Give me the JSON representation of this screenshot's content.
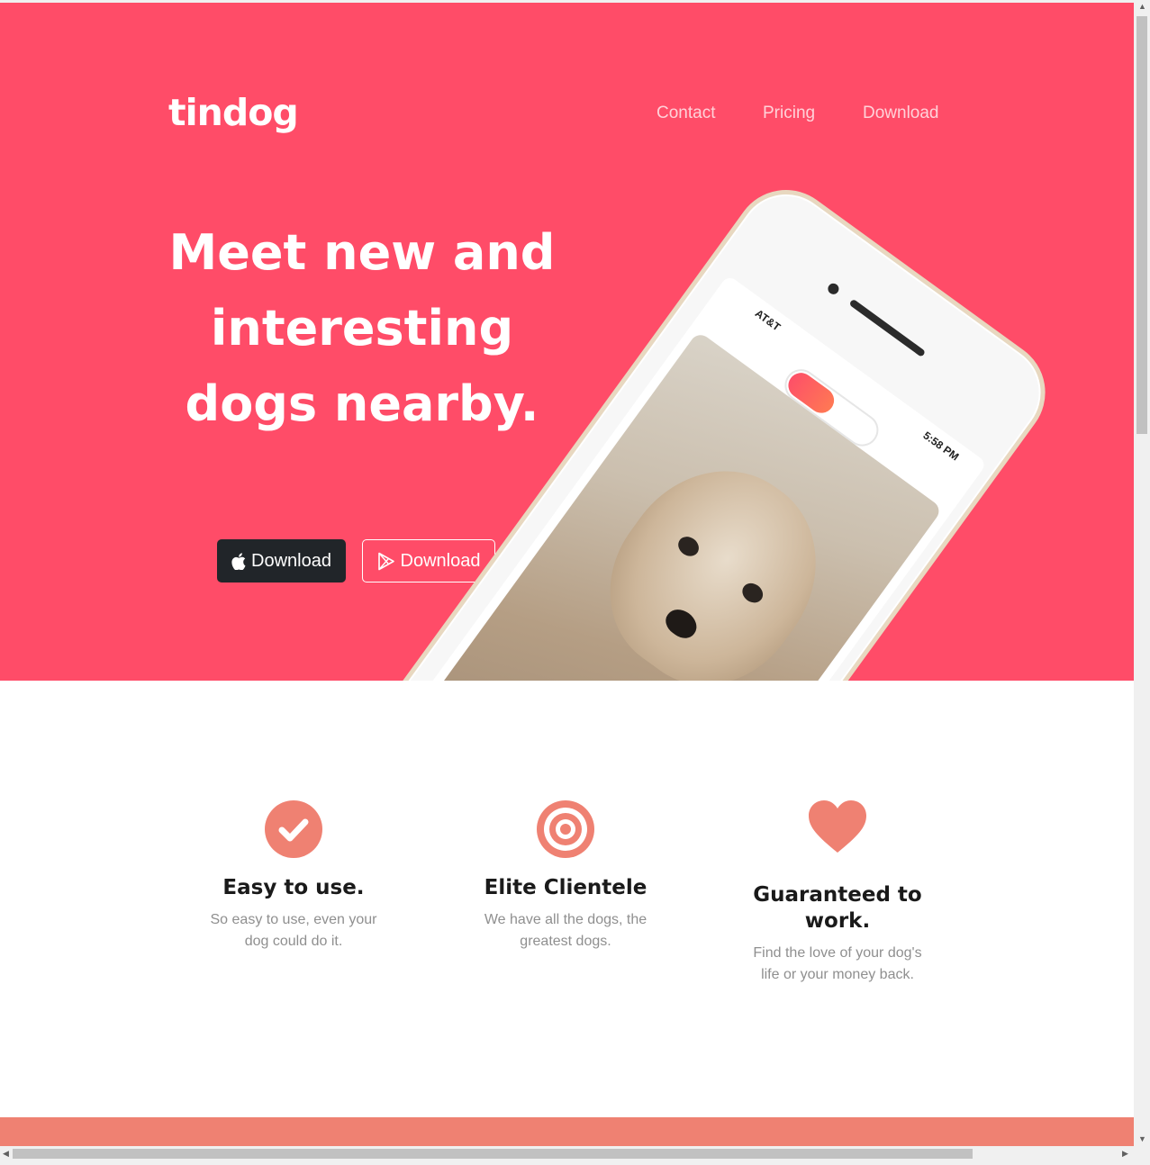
{
  "brand": "tindog",
  "nav": {
    "items": [
      {
        "label": "Contact"
      },
      {
        "label": "Pricing"
      },
      {
        "label": "Download"
      }
    ]
  },
  "hero": {
    "title": "Meet new and interesting dogs nearby.",
    "buttons": {
      "apple_label": "Download",
      "google_label": "Download"
    },
    "phone": {
      "carrier": "AT&T",
      "time": "5:58 PM"
    }
  },
  "features": [
    {
      "icon": "check-circle-icon",
      "title": "Easy to use.",
      "text": "So easy to use, even your dog could do it."
    },
    {
      "icon": "bullseye-icon",
      "title": "Elite Clientele",
      "text": "We have all the dogs, the greatest dogs."
    },
    {
      "icon": "heart-icon",
      "title": "Guaranteed to work.",
      "text": "Find the love of your dog's life or your money back."
    }
  ],
  "colors": {
    "hero_bg": "#ff4c68",
    "accent": "#ef8172",
    "dark_button": "#212529"
  }
}
